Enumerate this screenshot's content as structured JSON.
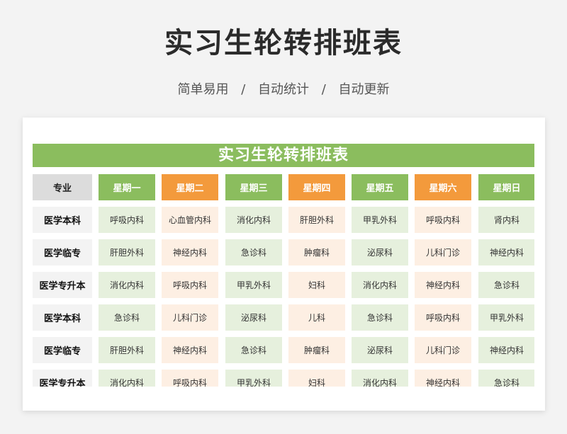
{
  "header": {
    "title": "实习生轮转排班表",
    "subtitle": [
      "简单易用",
      "自动统计",
      "自动更新"
    ],
    "separator": "/"
  },
  "table": {
    "banner": "实习生轮转排班表",
    "major_label": "专业",
    "days": [
      "星期一",
      "星期二",
      "星期三",
      "星期四",
      "星期五",
      "星期六",
      "星期日"
    ],
    "rows": [
      {
        "major": "医学本科",
        "cells": [
          "呼吸内科",
          "心血管内科",
          "消化内科",
          "肝胆外科",
          "甲乳外科",
          "呼吸内科",
          "肾内科"
        ]
      },
      {
        "major": "医学临专",
        "cells": [
          "肝胆外科",
          "神经内科",
          "急诊科",
          "肿瘤科",
          "泌尿科",
          "儿科门诊",
          "神经内科"
        ]
      },
      {
        "major": "医学专升本",
        "cells": [
          "消化内科",
          "呼吸内科",
          "甲乳外科",
          "妇科",
          "消化内科",
          "神经内科",
          "急诊科"
        ]
      },
      {
        "major": "医学本科",
        "cells": [
          "急诊科",
          "儿科门诊",
          "泌尿科",
          "儿科",
          "急诊科",
          "呼吸内科",
          "甲乳外科"
        ]
      },
      {
        "major": "医学临专",
        "cells": [
          "肝胆外科",
          "神经内科",
          "急诊科",
          "肿瘤科",
          "泌尿科",
          "儿科门诊",
          "神经内科"
        ]
      },
      {
        "major": "医学专升本",
        "cells": [
          "消化内科",
          "呼吸内科",
          "甲乳外科",
          "妇科",
          "消化内科",
          "神经内科",
          "急诊科"
        ]
      }
    ]
  },
  "colors": {
    "green": "#8bbd5e",
    "orange": "#f39a3c",
    "green_cell": "#e6f0dd",
    "orange_cell": "#fdefe3"
  }
}
